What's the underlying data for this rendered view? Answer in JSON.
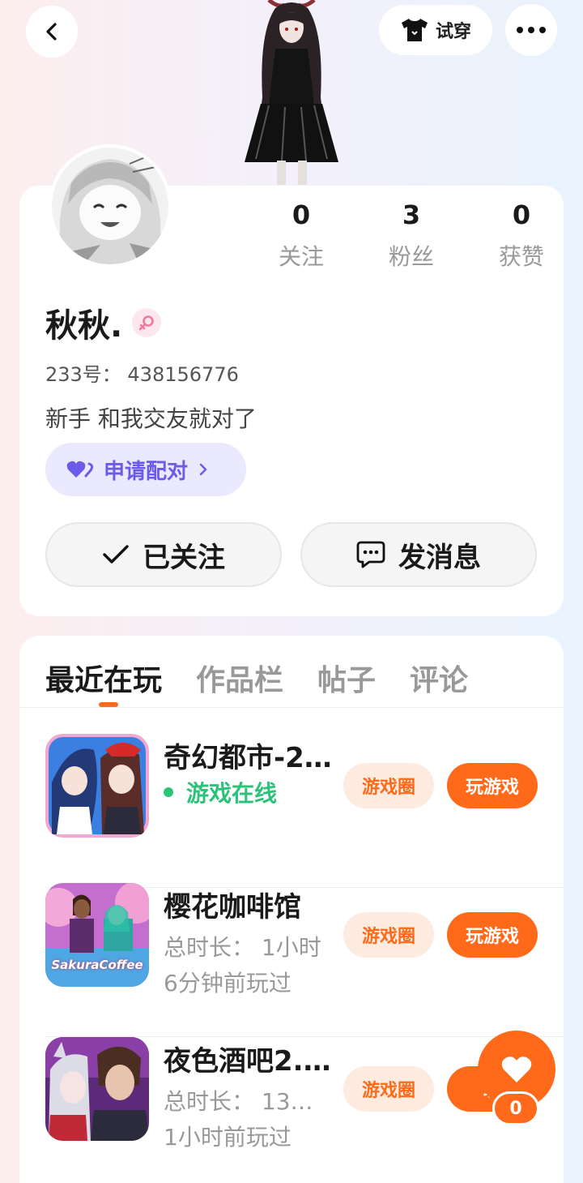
{
  "header": {
    "back_icon": "chevron-left-icon",
    "tryon_label": "试穿",
    "tryon_icon": "tshirt-icon",
    "more_icon": "ellipsis-icon"
  },
  "profile": {
    "stats": [
      {
        "value": "0",
        "label": "关注"
      },
      {
        "value": "3",
        "label": "粉丝"
      },
      {
        "value": "0",
        "label": "获赞"
      }
    ],
    "name": "秋秋.",
    "gender_icon": "female-icon",
    "uid": "233号： 438156776",
    "bio": "新手 和我交友就对了",
    "match_label": "申请配对",
    "follow_label": "已关注",
    "message_label": "发消息"
  },
  "tabs": [
    "最近在玩",
    "作品栏",
    "帖子",
    "评论"
  ],
  "games": [
    {
      "title": "奇幻都市-2…",
      "line1": "游戏在线",
      "line2": "",
      "online": true,
      "circle_label": "游戏圈",
      "play_label": "玩游戏"
    },
    {
      "title": "樱花咖啡馆",
      "line1": "总时长： 1小时",
      "line2": "6分钟前玩过",
      "online": false,
      "circle_label": "游戏圈",
      "play_label": "玩游戏"
    },
    {
      "title": "夜色酒吧2.…",
      "line1": "总时长： 13…",
      "line2": "1小时前玩过",
      "online": false,
      "circle_label": "游戏圈",
      "play_label": "玩"
    }
  ],
  "game_icon_labels": {
    "sakura": "SakuraCoffee"
  },
  "like": {
    "count": "0"
  },
  "colors": {
    "accent": "#ff6a1a",
    "online": "#2cc27a",
    "match": "#6a5be8"
  }
}
